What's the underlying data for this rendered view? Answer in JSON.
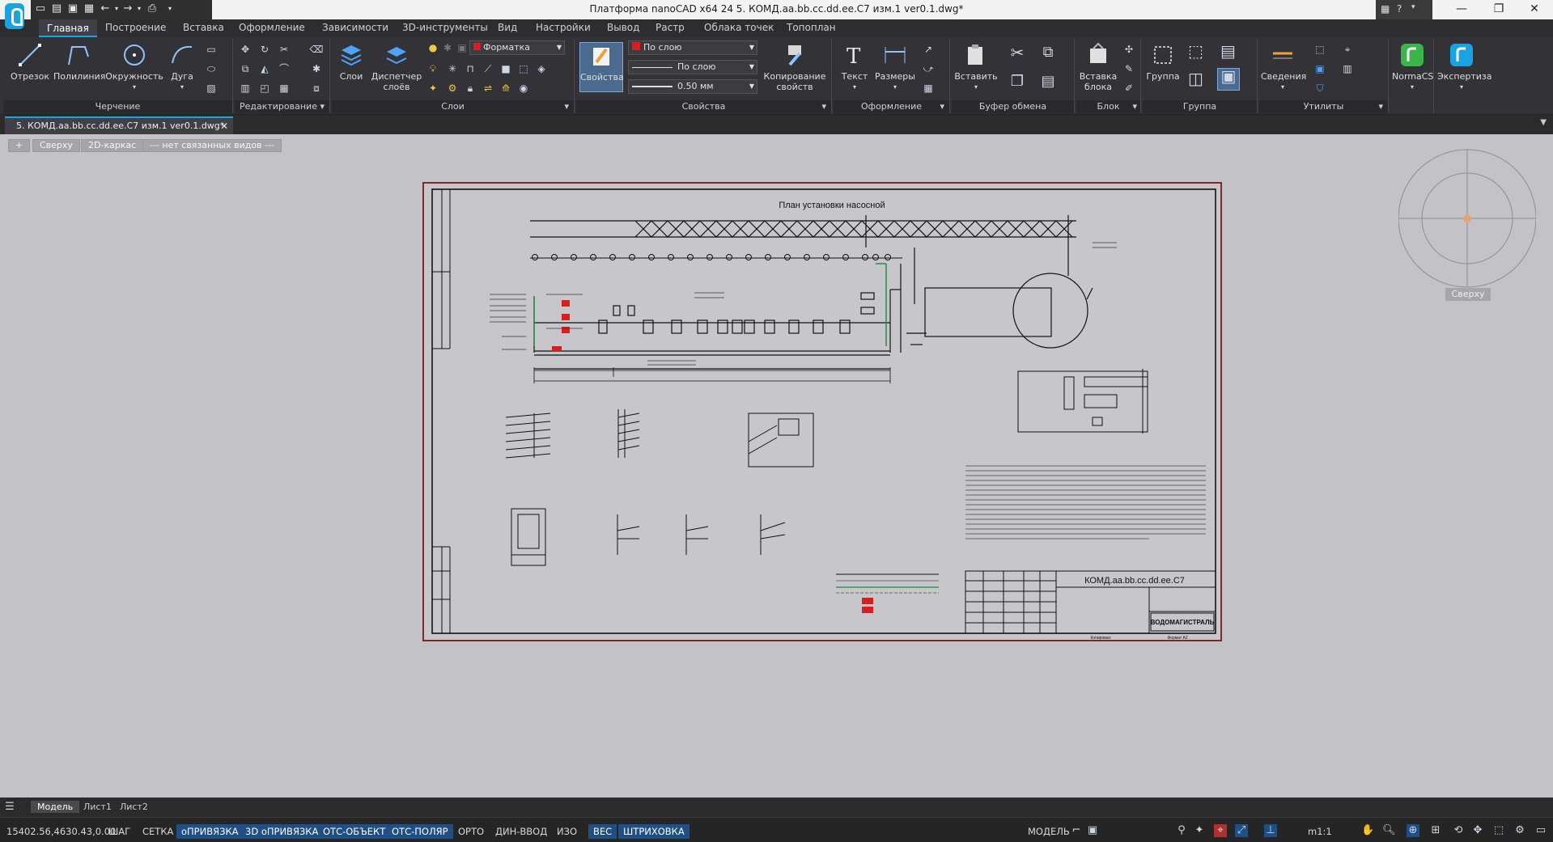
{
  "title_bar": {
    "title": "Платформа nanoCAD x64 24 5. КОМД.аа.bb.cc.dd.ee.С7 изм.1 ver0.1.dwg*",
    "help": "?",
    "minimize_icon": "minimize-icon",
    "restore_icon": "restore-icon",
    "close_icon": "close-icon"
  },
  "menu_tabs": [
    "Главная",
    "Построение",
    "Вставка",
    "Оформление",
    "Зависимости",
    "3D-инструменты",
    "Вид",
    "Настройки",
    "Вывод",
    "Растр",
    "Облака точек",
    "Топоплан"
  ],
  "ribbon": {
    "draw": {
      "label": "Черчение",
      "line": "Отрезок",
      "polyline": "Полилиния",
      "circle": "Окружность",
      "arc": "Дуга"
    },
    "edit": {
      "label": "Редактирование"
    },
    "layers": {
      "label": "Слои",
      "layers_btn": "Слои",
      "manager_line1": "Диспетчер",
      "manager_line2": "слоёв",
      "current_layer": "Форматка"
    },
    "props": {
      "label": "Свойства",
      "props_btn": "Свойства",
      "color": "По слою",
      "linetype": "По слою",
      "lineweight": "0.50 мм",
      "copy_line1": "Копирование",
      "copy_line2": "свойств"
    },
    "format": {
      "label": "Оформление",
      "text": "Текст",
      "dims": "Размеры"
    },
    "clipboard": {
      "label": "Буфер обмена",
      "paste": "Вставить"
    },
    "block": {
      "label": "Блок",
      "insert_line1": "Вставка",
      "insert_line2": "блока"
    },
    "group": {
      "label": "Группа",
      "group_btn": "Группа"
    },
    "utils": {
      "label": "Утилиты",
      "info": "Сведения"
    },
    "normacs": {
      "label": "NormaCS"
    },
    "expertise": {
      "label": "Экспертиза"
    }
  },
  "document_tab": "5. КОМД.аа.bb.cc.dd.ee.С7 изм.1 ver0.1.dwg*",
  "view_controls": {
    "plus": "+",
    "view": "Сверху",
    "style": "2D-каркас",
    "linked": "--- нет связанных видов ---"
  },
  "compass_label": "Сверху",
  "drawing": {
    "plan_title": "План установки насосной",
    "stamp_code": "КОМД.аа.bb.cc.dd.ee.С7",
    "stamp_company": "ВОДОМАГИСТРАЛЬ",
    "stamp_reserve": "Копировал",
    "stamp_format": "Формат А2",
    "accent_red": "#d81e1e",
    "accent_green": "#1c8a3a",
    "accent_brown": "#7a2b2b"
  },
  "layout_tabs": [
    "Модель",
    "Лист1",
    "Лист2"
  ],
  "status_bar": {
    "coords": "15402.56,4630.43,0.00",
    "toggles": [
      {
        "label": "ШАГ",
        "on": false
      },
      {
        "label": "СЕТКА",
        "on": false
      },
      {
        "label": "оПРИВЯЗКА",
        "on": true
      },
      {
        "label": "3D оПРИВЯЗКА",
        "on": true
      },
      {
        "label": "ОТС-ОБЪЕКТ",
        "on": true
      },
      {
        "label": "ОТС-ПОЛЯР",
        "on": true
      },
      {
        "label": "ОРТО",
        "on": false
      },
      {
        "label": "ДИН-ВВОД",
        "on": false
      },
      {
        "label": "ИЗО",
        "on": false
      },
      {
        "label": "ВЕС",
        "on": true
      },
      {
        "label": "ШТРИХОВКА",
        "on": true
      }
    ],
    "mode": "МОДЕЛЬ",
    "scale": "m1:1"
  }
}
